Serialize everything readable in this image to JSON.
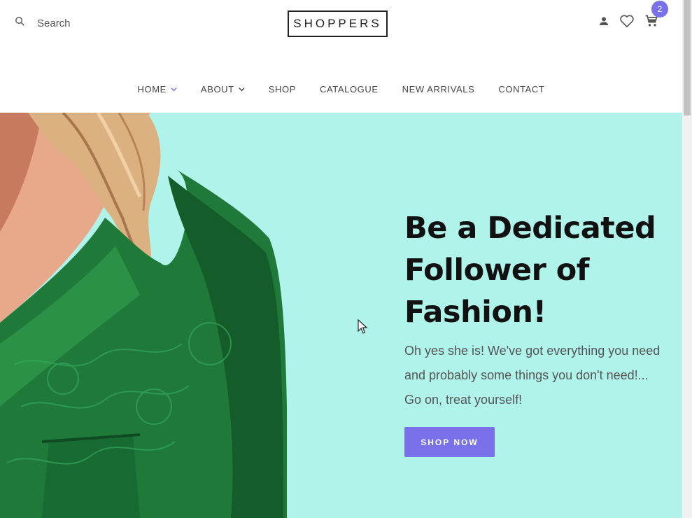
{
  "header": {
    "search_placeholder": "Search",
    "logo": "SHOPPERS",
    "cart_count": "2",
    "icons": [
      "search-icon",
      "user-icon",
      "heart-icon",
      "cart-icon"
    ]
  },
  "nav": {
    "items": [
      {
        "label": "HOME",
        "has_dropdown": true,
        "active": true
      },
      {
        "label": "ABOUT",
        "has_dropdown": true,
        "active": false
      },
      {
        "label": "SHOP",
        "has_dropdown": false,
        "active": false
      },
      {
        "label": "CATALOGUE",
        "has_dropdown": false,
        "active": false
      },
      {
        "label": "NEW ARRIVALS",
        "has_dropdown": false,
        "active": false
      },
      {
        "label": "CONTACT",
        "has_dropdown": false,
        "active": false
      }
    ]
  },
  "hero": {
    "title_lines": [
      "Be a Dedicated",
      "Follower of",
      "Fashion!"
    ],
    "subtitle_lines": [
      "Oh yes she is! We've got everything you need",
      "and probably some things you don't need!...",
      "Go on, treat yourself!"
    ],
    "button_label": "SHOP NOW"
  },
  "colors": {
    "accent": "#7971ea",
    "hero_background": "#aff3eb",
    "text_dark": "#111111"
  }
}
